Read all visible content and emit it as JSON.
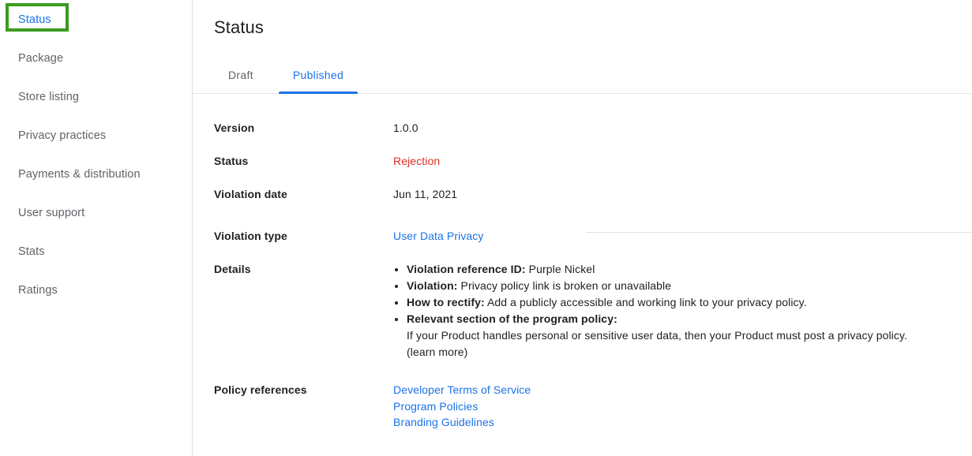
{
  "sidebar": {
    "items": [
      {
        "label": "Status",
        "active": true
      },
      {
        "label": "Package",
        "active": false
      },
      {
        "label": "Store listing",
        "active": false
      },
      {
        "label": "Privacy practices",
        "active": false
      },
      {
        "label": "Payments & distribution",
        "active": false
      },
      {
        "label": "User support",
        "active": false
      },
      {
        "label": "Stats",
        "active": false
      },
      {
        "label": "Ratings",
        "active": false
      }
    ],
    "highlight_color": "#3c9a1e",
    "active_color": "#1a73e8"
  },
  "main": {
    "title": "Status",
    "tabs": [
      {
        "label": "Draft",
        "selected": false
      },
      {
        "label": "Published",
        "selected": true
      }
    ],
    "accent_color": "#1a73e8",
    "rows": {
      "version": {
        "label": "Version",
        "value": "1.0.0"
      },
      "status": {
        "label": "Status",
        "value": "Rejection",
        "value_color": "#d93025"
      },
      "violation_date": {
        "label": "Violation date",
        "value": "Jun 11, 2021"
      },
      "violation_type": {
        "label": "Violation type",
        "value": "User Data Privacy"
      },
      "details": {
        "label": "Details",
        "bullets": [
          {
            "bold": "Violation reference ID:",
            "text": " Purple Nickel"
          },
          {
            "bold": "Violation:",
            "text": " Privacy policy link is broken or unavailable"
          },
          {
            "bold": "How to rectify:",
            "text": " Add a publicly accessible and working link to your privacy policy."
          },
          {
            "bold": "Relevant section of the program policy:",
            "text": ""
          }
        ],
        "sub_text": "If your Product handles personal or sensitive user data, then your Product must post a privacy policy.",
        "learn_more": "(learn more)"
      },
      "policy_references": {
        "label": "Policy references",
        "links": [
          "Developer Terms of Service",
          "Program Policies",
          "Branding Guidelines"
        ]
      }
    }
  }
}
